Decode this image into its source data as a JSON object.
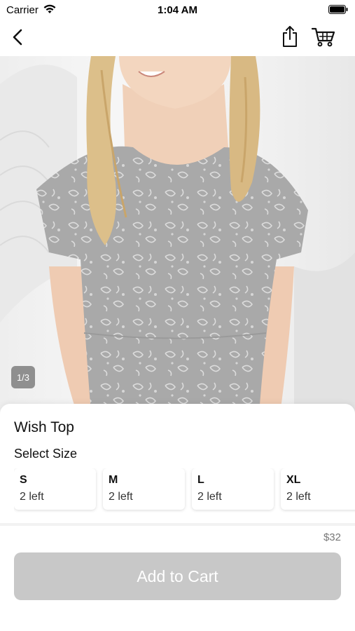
{
  "status_bar": {
    "carrier": "Carrier",
    "time": "1:04 AM"
  },
  "nav": {
    "back_icon": "chevron-left-icon",
    "share_icon": "share-icon",
    "cart_icon": "cart-icon"
  },
  "gallery": {
    "counter": "1/3"
  },
  "product": {
    "title": "Wish Top",
    "size_heading": "Select Size",
    "sizes": [
      {
        "label": "S",
        "stock": "2 left"
      },
      {
        "label": "M",
        "stock": "2 left"
      },
      {
        "label": "L",
        "stock": "2 left"
      },
      {
        "label": "XL",
        "stock": "2 left"
      }
    ],
    "price": "$32",
    "add_to_cart_label": "Add to Cart"
  },
  "colors": {
    "button_disabled": "#c8c8c8",
    "price_text": "#777777"
  }
}
